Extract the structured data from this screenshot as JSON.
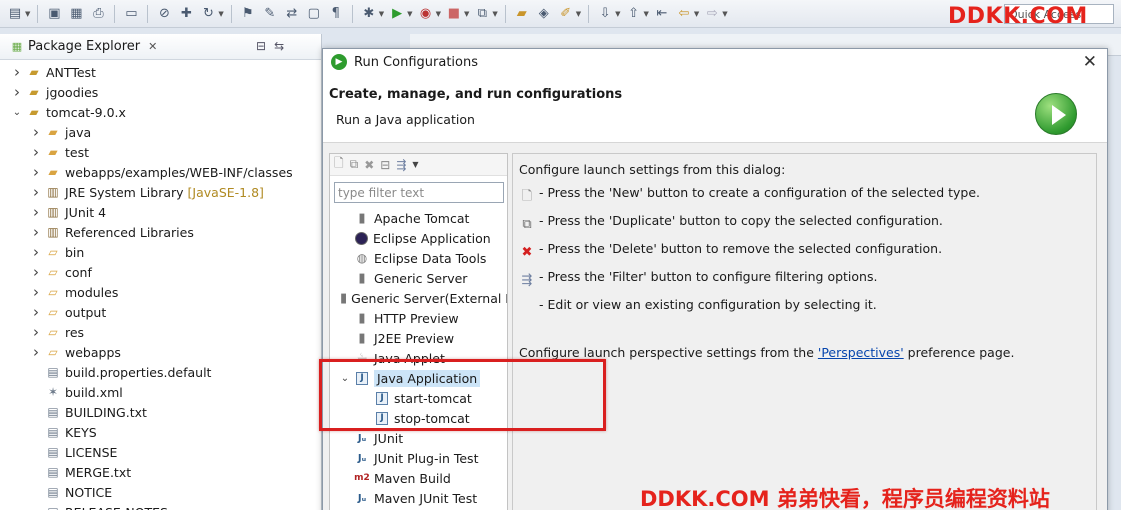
{
  "quick_access": "Quick Access",
  "watermark_top": "DDKK.COM",
  "watermark_bottom": "DDKK.COM 弟弟快看，程序员编程资料站",
  "package_explorer": {
    "title": "Package Explorer",
    "items": [
      {
        "label": "ANTTest",
        "icon": "project-icon",
        "expanded": false,
        "level": 0,
        "decor": ""
      },
      {
        "label": "jgoodies",
        "icon": "project-icon",
        "expanded": false,
        "level": 0,
        "decor": ""
      },
      {
        "label": "tomcat-9.0.x",
        "icon": "project-icon",
        "expanded": true,
        "level": 0,
        "decor": ""
      },
      {
        "label": "java",
        "icon": "source-folder-icon",
        "expanded": false,
        "level": 1,
        "decor": ""
      },
      {
        "label": "test",
        "icon": "source-folder-icon",
        "expanded": false,
        "level": 1,
        "decor": ""
      },
      {
        "label": "webapps/examples/WEB-INF/classes",
        "icon": "source-folder-icon",
        "expanded": false,
        "level": 1,
        "decor": ""
      },
      {
        "label": "JRE System Library",
        "icon": "library-icon",
        "expanded": false,
        "level": 1,
        "decor": "[JavaSE-1.8]"
      },
      {
        "label": "JUnit 4",
        "icon": "library-icon",
        "expanded": false,
        "level": 1,
        "decor": ""
      },
      {
        "label": "Referenced Libraries",
        "icon": "library-icon",
        "expanded": false,
        "level": 1,
        "decor": ""
      },
      {
        "label": "bin",
        "icon": "folder-icon",
        "expanded": false,
        "level": 1,
        "decor": ""
      },
      {
        "label": "conf",
        "icon": "folder-icon",
        "expanded": false,
        "level": 1,
        "decor": ""
      },
      {
        "label": "modules",
        "icon": "folder-icon",
        "expanded": false,
        "level": 1,
        "decor": ""
      },
      {
        "label": "output",
        "icon": "folder-icon",
        "expanded": false,
        "level": 1,
        "decor": ""
      },
      {
        "label": "res",
        "icon": "folder-icon",
        "expanded": false,
        "level": 1,
        "decor": ""
      },
      {
        "label": "webapps",
        "icon": "folder-icon",
        "expanded": false,
        "level": 1,
        "decor": ""
      },
      {
        "label": "build.properties.default",
        "icon": "file-icon",
        "expanded": null,
        "level": 1,
        "decor": ""
      },
      {
        "label": "build.xml",
        "icon": "ant-file-icon",
        "expanded": null,
        "level": 1,
        "decor": ""
      },
      {
        "label": "BUILDING.txt",
        "icon": "text-file-icon",
        "expanded": null,
        "level": 1,
        "decor": ""
      },
      {
        "label": "KEYS",
        "icon": "file-icon",
        "expanded": null,
        "level": 1,
        "decor": ""
      },
      {
        "label": "LICENSE",
        "icon": "file-icon",
        "expanded": null,
        "level": 1,
        "decor": ""
      },
      {
        "label": "MERGE.txt",
        "icon": "text-file-icon",
        "expanded": null,
        "level": 1,
        "decor": ""
      },
      {
        "label": "NOTICE",
        "icon": "file-icon",
        "expanded": null,
        "level": 1,
        "decor": ""
      },
      {
        "label": "RELEASE-NOTES",
        "icon": "file-icon",
        "expanded": null,
        "level": 1,
        "decor": ""
      }
    ]
  },
  "dialog": {
    "title": "Run Configurations",
    "heading": "Create, manage, and run configurations",
    "subheading": "Run a Java application",
    "filter_placeholder": "type filter text",
    "config_types": [
      {
        "label": "Apache Tomcat",
        "icon": "tomcat-icon",
        "level": 0,
        "expanded": null,
        "selected": false
      },
      {
        "label": "Eclipse Application",
        "icon": "eclipse-icon",
        "level": 0,
        "expanded": null,
        "selected": false
      },
      {
        "label": "Eclipse Data Tools",
        "icon": "database-icon",
        "level": 0,
        "expanded": null,
        "selected": false
      },
      {
        "label": "Generic Server",
        "icon": "tomcat-icon",
        "level": 0,
        "expanded": null,
        "selected": false
      },
      {
        "label": "Generic Server(External Launch)",
        "icon": "tomcat-icon",
        "level": 0,
        "expanded": null,
        "selected": false
      },
      {
        "label": "HTTP Preview",
        "icon": "tomcat-icon",
        "level": 0,
        "expanded": null,
        "selected": false
      },
      {
        "label": "J2EE Preview",
        "icon": "tomcat-icon",
        "level": 0,
        "expanded": null,
        "selected": false
      },
      {
        "label": "Java Applet",
        "icon": "java-applet-icon",
        "level": 0,
        "expanded": null,
        "selected": false
      },
      {
        "label": "Java Application",
        "icon": "java-app-icon",
        "level": 0,
        "expanded": true,
        "selected": true
      },
      {
        "label": "start-tomcat",
        "icon": "java-app-icon",
        "level": 1,
        "expanded": null,
        "selected": false
      },
      {
        "label": "stop-tomcat",
        "icon": "java-app-icon",
        "level": 1,
        "expanded": null,
        "selected": false
      },
      {
        "label": "JUnit",
        "icon": "junit-icon",
        "level": 0,
        "expanded": null,
        "selected": false
      },
      {
        "label": "JUnit Plug-in Test",
        "icon": "junit-icon",
        "level": 0,
        "expanded": null,
        "selected": false
      },
      {
        "label": "Maven Build",
        "icon": "maven-icon",
        "level": 0,
        "expanded": null,
        "selected": false
      },
      {
        "label": "Maven JUnit Test",
        "icon": "junit-icon",
        "level": 0,
        "expanded": null,
        "selected": false
      }
    ],
    "right": {
      "intro": "Configure launch settings from this dialog:",
      "tips": [
        {
          "icon": "new-config-icon",
          "text": "- Press the 'New' button to create a configuration of the selected type."
        },
        {
          "icon": "duplicate-icon",
          "text": "- Press the 'Duplicate' button to copy the selected configuration."
        },
        {
          "icon": "delete-icon",
          "text": "- Press the 'Delete' button to remove the selected configuration."
        },
        {
          "icon": "filter-icon",
          "text": "- Press the 'Filter' button to configure filtering options."
        },
        {
          "icon": "",
          "text": "- Edit or view an existing configuration by selecting it."
        }
      ],
      "perspective_before": "Configure launch perspective settings from the ",
      "perspective_link": "'Perspectives'",
      "perspective_after": " preference page."
    }
  }
}
